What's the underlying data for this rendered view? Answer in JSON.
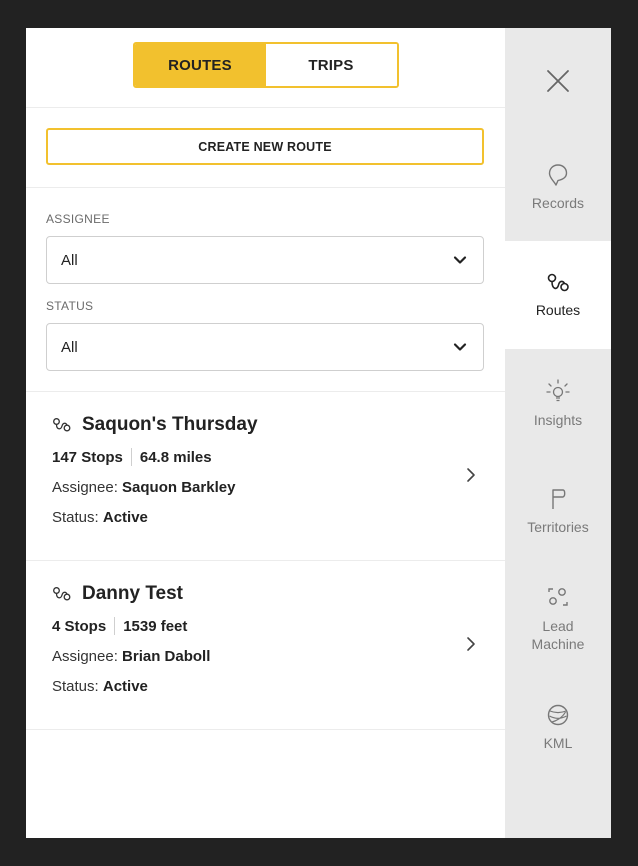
{
  "toggle": {
    "routes_label": "ROUTES",
    "trips_label": "TRIPS"
  },
  "create_button_label": "CREATE NEW ROUTE",
  "filters": {
    "assignee_label": "ASSIGNEE",
    "assignee_value": "All",
    "status_label": "STATUS",
    "status_value": "All"
  },
  "routes": [
    {
      "name": "Saquon's Thursday",
      "stops": "147 Stops",
      "distance": "64.8 miles",
      "assignee_label": "Assignee:",
      "assignee": "Saquon Barkley",
      "status_label": "Status:",
      "status": "Active"
    },
    {
      "name": "Danny Test",
      "stops": "4 Stops",
      "distance": "1539 feet",
      "assignee_label": "Assignee:",
      "assignee": "Brian Daboll",
      "status_label": "Status:",
      "status": "Active"
    }
  ],
  "rail": {
    "records": "Records",
    "routes": "Routes",
    "insights": "Insights",
    "territories": "Territories",
    "lead_line1": "Lead",
    "lead_line2": "Machine",
    "kml": "KML"
  },
  "colors": {
    "accent": "#f2c12e",
    "rail_bg": "#e9e9e9",
    "outer_bg": "#222222"
  },
  "icons": [
    "close-icon",
    "records-pin-icon",
    "routes-icon",
    "insights-bulb-icon",
    "territories-flag-icon",
    "lead-machine-icon",
    "kml-globe-icon",
    "chevron-down-icon",
    "chevron-right-icon",
    "route-icon"
  ]
}
